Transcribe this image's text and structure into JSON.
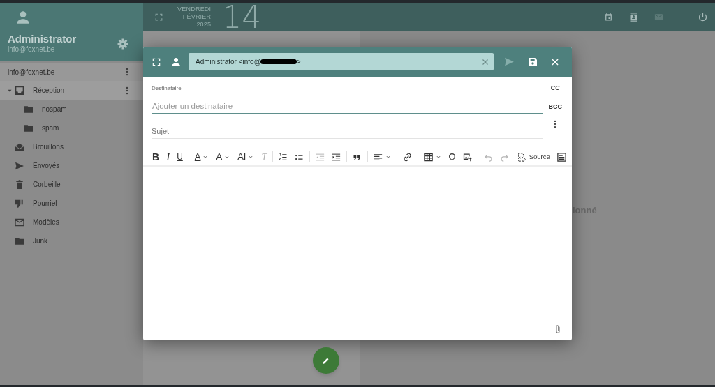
{
  "topbar": {
    "weekday": "VENDREDI",
    "month": "FÉVRIER",
    "year": "2025",
    "day": "14",
    "apps": [
      {
        "kind": "calendar",
        "disabled": false
      },
      {
        "kind": "contacts",
        "disabled": false
      },
      {
        "kind": "mail",
        "disabled": true
      },
      {
        "kind": "power",
        "disabled": false
      }
    ]
  },
  "account": {
    "name": "Administrator",
    "email": "info@foxnet.be"
  },
  "mailbox": {
    "label": "info@foxnet.be"
  },
  "folders": [
    {
      "label": "Réception",
      "kind": "inbox",
      "selected": true,
      "expanded": true,
      "children": [
        {
          "label": "nospam",
          "kind": "folder",
          "selected": false
        },
        {
          "label": "spam",
          "kind": "folder",
          "selected": false
        }
      ]
    },
    {
      "label": "Brouillons",
      "kind": "drafts",
      "selected": false
    },
    {
      "label": "Envoyés",
      "kind": "sent",
      "selected": false
    },
    {
      "label": "Corbeille",
      "kind": "trash",
      "selected": false
    },
    {
      "label": "Pourriel",
      "kind": "spam",
      "selected": false
    },
    {
      "label": "Modèles",
      "kind": "template",
      "selected": false
    },
    {
      "label": "Junk",
      "kind": "folder",
      "selected": false
    }
  ],
  "reading_pane": {
    "empty_text": "ionné"
  },
  "compose": {
    "from_start": "Administrator <info@",
    "from_end": ">",
    "send_disabled": true,
    "recipient_label": "Destinataire",
    "recipient_placeholder": "Ajouter un destinataire",
    "cc": "CC",
    "bcc": "BCC",
    "subject_placeholder": "Sujet",
    "toolbar": [
      {
        "kind": "bold",
        "glyph": "B",
        "disabled": false
      },
      {
        "kind": "italic",
        "glyph": "I",
        "disabled": false
      },
      {
        "kind": "underline",
        "glyph": "U",
        "disabled": false
      },
      {
        "kind": "separator"
      },
      {
        "kind": "font-color",
        "glyph": "A",
        "dropdown": true,
        "disabled": false
      },
      {
        "kind": "font-family",
        "glyph": "A",
        "dropdown": true,
        "disabled": false
      },
      {
        "kind": "font-size",
        "glyph": "AI",
        "dropdown": true,
        "disabled": false
      },
      {
        "kind": "clear-format",
        "glyph": "T",
        "disabled": true
      },
      {
        "kind": "separator"
      },
      {
        "kind": "numbered-list",
        "disabled": false
      },
      {
        "kind": "bullet-list",
        "disabled": false
      },
      {
        "kind": "separator"
      },
      {
        "kind": "outdent",
        "disabled": true
      },
      {
        "kind": "indent",
        "disabled": false
      },
      {
        "kind": "separator"
      },
      {
        "kind": "quote",
        "disabled": false
      },
      {
        "kind": "separator"
      },
      {
        "kind": "align",
        "dropdown": true,
        "disabled": false
      },
      {
        "kind": "separator"
      },
      {
        "kind": "link",
        "disabled": false
      },
      {
        "kind": "separator"
      },
      {
        "kind": "table",
        "dropdown": true,
        "disabled": false
      },
      {
        "kind": "special-char",
        "glyph": "Ω",
        "disabled": false
      },
      {
        "kind": "image",
        "disabled": false
      },
      {
        "kind": "separator"
      },
      {
        "kind": "undo",
        "disabled": true
      },
      {
        "kind": "redo",
        "disabled": true
      },
      {
        "kind": "source",
        "label": "Source",
        "disabled": false
      },
      {
        "kind": "template",
        "disabled": false
      }
    ]
  }
}
